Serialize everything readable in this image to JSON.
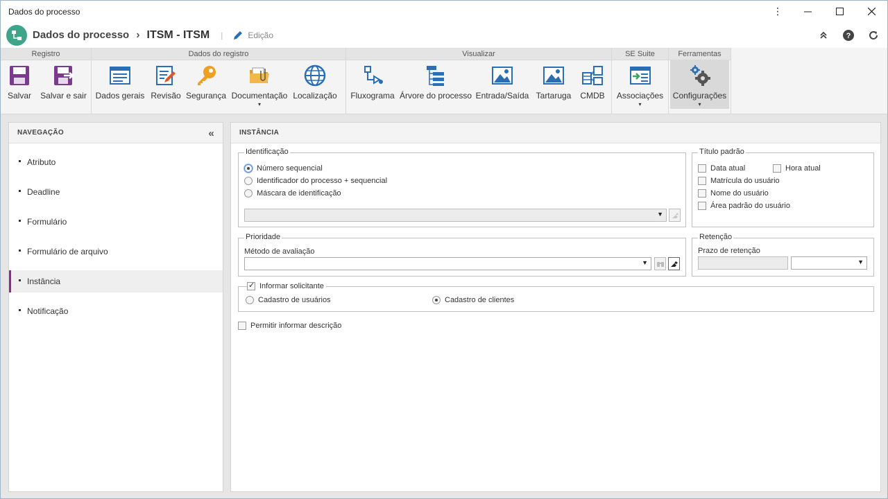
{
  "window": {
    "title": "Dados do processo"
  },
  "header": {
    "crumb": "Dados do processo",
    "separator": "›",
    "main_title": "ITSM - ITSM",
    "bar": "|",
    "mode_label": "Edição"
  },
  "ribbon": {
    "groups": [
      {
        "title": "Registro",
        "buttons": [
          {
            "label": "Salvar"
          },
          {
            "label": "Salvar e sair"
          }
        ]
      },
      {
        "title": "Dados do registro",
        "buttons": [
          {
            "label": "Dados gerais"
          },
          {
            "label": "Revisão"
          },
          {
            "label": "Segurança"
          },
          {
            "label": "Documentação"
          },
          {
            "label": "Localização"
          }
        ]
      },
      {
        "title": "Visualizar",
        "buttons": [
          {
            "label": "Fluxograma"
          },
          {
            "label": "Árvore do processo"
          },
          {
            "label": "Entrada/Saída"
          },
          {
            "label": "Tartaruga"
          },
          {
            "label": "CMDB"
          }
        ]
      },
      {
        "title": "SE Suite",
        "buttons": [
          {
            "label": "Associações"
          }
        ]
      },
      {
        "title": "Ferramentas",
        "buttons": [
          {
            "label": "Configurações"
          }
        ]
      }
    ],
    "caret": "▾"
  },
  "nav": {
    "title": "NAVEGAÇÃO",
    "collapse": "«",
    "items": [
      {
        "label": "Atributo"
      },
      {
        "label": "Deadline"
      },
      {
        "label": "Formulário"
      },
      {
        "label": "Formulário de arquivo"
      },
      {
        "label": "Instância"
      },
      {
        "label": "Notificação"
      }
    ],
    "active": "Instância"
  },
  "main": {
    "title": "INSTÂNCIA",
    "identificacao": {
      "legend": "Identificação",
      "options": [
        {
          "label": "Número sequencial",
          "selected": true
        },
        {
          "label": "Identificador do processo + sequencial",
          "selected": false
        },
        {
          "label": "Máscara de identificação",
          "selected": false
        }
      ],
      "mask_value": ""
    },
    "titulo_padrao": {
      "legend": "Título padrão",
      "options": [
        {
          "label": "Data atual",
          "checked": false
        },
        {
          "label": "Hora atual",
          "checked": false
        },
        {
          "label": "Matrícula do usuário",
          "checked": false
        },
        {
          "label": "Nome do usuário",
          "checked": false
        },
        {
          "label": "Área padrão do usuário",
          "checked": false
        }
      ]
    },
    "prioridade": {
      "legend": "Prioridade",
      "method_label": "Método de avaliação",
      "method_value": ""
    },
    "retencao": {
      "legend": "Retenção",
      "prazo_label": "Prazo de retenção",
      "prazo_value": "",
      "unit_value": ""
    },
    "solicitante": {
      "label": "Informar solicitante",
      "checked": true,
      "options": [
        {
          "label": "Cadastro de usuários",
          "selected": false
        },
        {
          "label": "Cadastro de clientes",
          "selected": true
        }
      ]
    },
    "descricao": {
      "label": "Permitir informar descrição",
      "checked": false
    }
  },
  "colors": {
    "accent": "#8b2c8f",
    "app_icon": "#3fa58a",
    "icon_purple": "#7a3b8f",
    "icon_blue": "#2a6fb5"
  }
}
